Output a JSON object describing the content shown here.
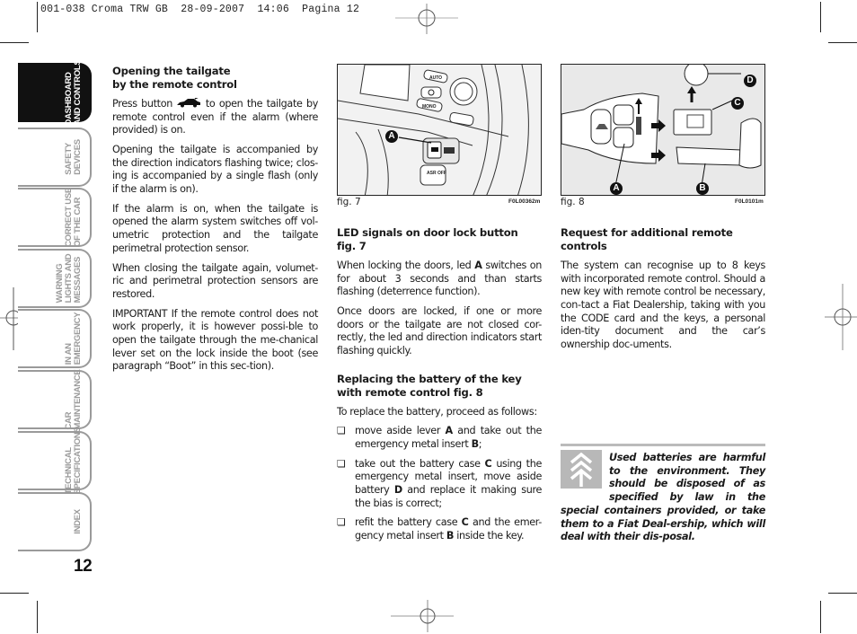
{
  "print_slug": "001-038 Croma TRW GB  28-09-2007  14:06  Pagina 12",
  "sidebar": {
    "tabs": [
      {
        "label": "DASHBOARD\nAND CONTROLS",
        "active": true
      },
      {
        "label": "SAFETY\nDEVICES",
        "active": false
      },
      {
        "label": "CORRECT USE\nOF THE CAR",
        "active": false
      },
      {
        "label": "WARNING\nLIGHTS AND\nMESSAGES",
        "active": false
      },
      {
        "label": "IN AN\nEMERGENCY",
        "active": false
      },
      {
        "label": "CAR\nMAINTENANCE",
        "active": false
      },
      {
        "label": "TECHNICAL\nSPECIFICATIONS",
        "active": false
      },
      {
        "label": "INDEX",
        "active": false
      }
    ],
    "page_number": "12"
  },
  "col1": {
    "heading": "Opening the tailgate\nby the remote control",
    "p1_before": "Press button ",
    "p1_icon": "car-tailgate-icon",
    "p1_after": " to open the tailgate by remote control even if the alarm (where provided) is on.",
    "p2": "Opening the tailgate is accompanied by the direction indicators flashing twice; clos-ing is accompanied by a single flash (only if the alarm is on).",
    "p3": "If the alarm is on, when the tailgate is opened the alarm system switches off vol-umetric protection and the tailgate perimetral protection sensor.",
    "p4": "When closing the tailgate again, volumet-ric and perimetral protection sensors are restored.",
    "p5": "IMPORTANT If the remote control does not work properly, it is however possi-ble to open the tailgate through the me-chanical lever set on the lock inside the boot (see paragraph “Boot” in this sec-tion)."
  },
  "fig7": {
    "caption": "fig. 7",
    "code": "F0L00362m",
    "callouts": [
      "A"
    ],
    "buttons": [
      "AUTO",
      "MONO",
      "ASR OFF"
    ]
  },
  "fig8": {
    "caption": "fig. 8",
    "code": "F0L0101m",
    "callouts": [
      "A",
      "B",
      "C",
      "D"
    ]
  },
  "col2": {
    "heading1": "LED signals on door lock button\nfig. 7",
    "p1_a": "When locking the doors, led ",
    "p1_b": "A",
    "p1_c": " switches on for about 3 seconds and than starts flashing (deterrence function).",
    "p2": "Once doors are locked, if one or more doors or the tailgate are not closed cor-rectly, the led and direction indicators start flashing quickly.",
    "heading2": "Replacing the battery of the key\nwith remote control fig. 8",
    "intro": "To replace the battery, proceed as follows:",
    "bullet_glyph": "❏",
    "b1": [
      "move aside lever ",
      "A",
      " and take out the emergency metal insert ",
      "B",
      ";"
    ],
    "b2": [
      "take out the battery case ",
      "C",
      " using the emergency metal insert, move aside battery ",
      "D",
      " and replace it making sure the bias is correct;"
    ],
    "b3": [
      "refit the battery case ",
      "C",
      " and the emer-gency metal insert ",
      "B",
      " inside the key."
    ]
  },
  "col3": {
    "heading": "Request for additional remote\ncontrols",
    "p1": "The system can recognise up to 8 keys with incorporated remote control. Should a new key with remote control be necessary, con-tact a Fiat Dealership, taking with you the CODE card and the keys, a personal iden-tity document and the car’s ownership doc-uments.",
    "eco_icon": "environment-tree-icon",
    "eco_note": "Used batteries are harmful to the environment. They should be disposed of as specified by law in the special containers provided, or take them to a Fiat Deal-ership, which will deal with their dis-posal."
  }
}
